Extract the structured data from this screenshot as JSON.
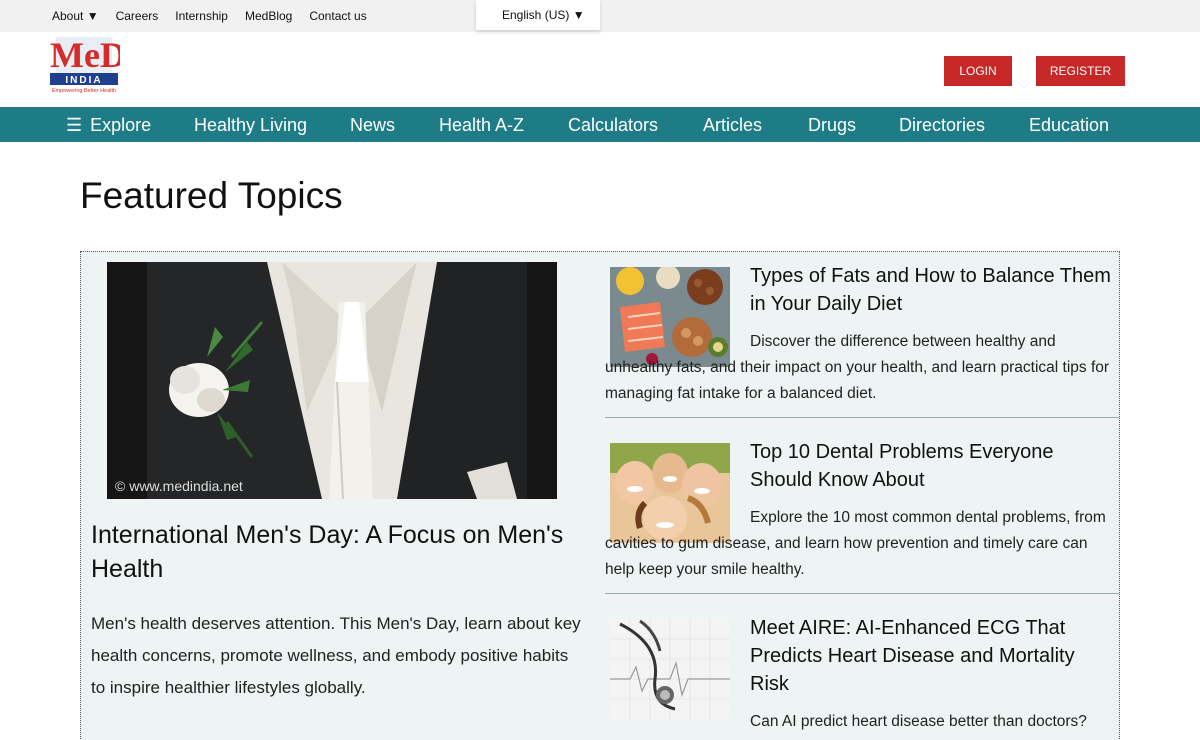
{
  "top_links": [
    "About ▼",
    "Careers",
    "Internship",
    "MedBlog",
    "Contact us"
  ],
  "language": "English (US) ▼",
  "logo": {
    "text_big": "MeD",
    "text_small": "INDIA",
    "tagline": "Empowering Better Health"
  },
  "buttons": {
    "login": "LOGIN",
    "register": "REGISTER"
  },
  "nav": {
    "explore": "Explore",
    "items": [
      "Healthy Living",
      "News",
      "Health A-Z",
      "Calculators",
      "Articles",
      "Drugs",
      "Directories",
      "Education"
    ]
  },
  "page_title": "Featured Topics",
  "featured": {
    "watermark": "© www.medindia.net",
    "title": "International Men's Day: A Focus on Men's Health",
    "description": "Men's health deserves attention. This Men's Day, learn about key health concerns, promote wellness, and embody positive habits to inspire healthier lifestyles globally."
  },
  "articles": [
    {
      "title": "Types of Fats and How to Balance Them in Your Daily Diet",
      "description": "Discover the difference between healthy and unhealthy fats, and their impact on your health, and learn practical tips for managing fat intake for a balanced diet."
    },
    {
      "title": "Top 10 Dental Problems Everyone Should Know About",
      "description": "Explore the 10 most common dental problems, from cavities to gum disease, and learn how prevention and timely care can help keep your smile healthy."
    },
    {
      "title": "Meet AIRE: AI-Enhanced ECG That Predicts Heart Disease and Mortality Risk",
      "description": "Can AI predict heart disease better than doctors?"
    }
  ],
  "colors": {
    "nav_bg": "#1d7c86",
    "button_red": "#c62727",
    "panel_bg": "#eef3f3"
  }
}
